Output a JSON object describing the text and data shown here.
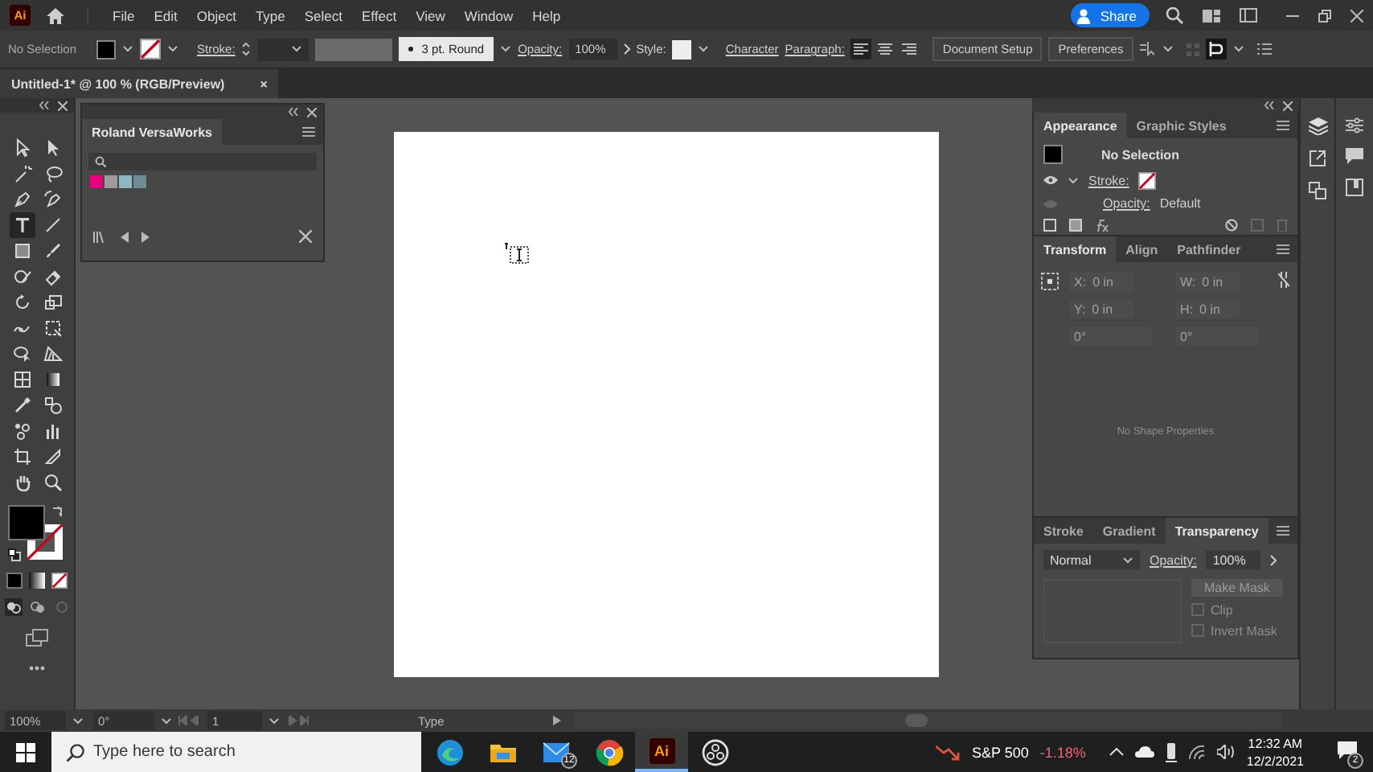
{
  "app_bar": {
    "logo": "Ai",
    "menus": [
      "File",
      "Edit",
      "Object",
      "Type",
      "Select",
      "Effect",
      "View",
      "Window",
      "Help"
    ],
    "share": "Share"
  },
  "control_bar": {
    "selection": "No Selection",
    "stroke_label": "Stroke:",
    "brush": "3 pt. Round",
    "opacity_label": "Opacity:",
    "opacity": "100%",
    "style_label": "Style:",
    "character": "Character",
    "paragraph_label": "Paragraph:",
    "alignment": [
      {
        "selected": true
      },
      {
        "selected": false
      },
      {
        "selected": false
      }
    ],
    "document_setup": "Document Setup",
    "preferences": "Preferences"
  },
  "document_tab": {
    "title": "Untitled-1* @ 100 % (RGB/Preview)",
    "close": "×"
  },
  "tools": [
    {
      "kind": "selection",
      "selected": false
    },
    {
      "kind": "direct-selection",
      "selected": false
    },
    {
      "kind": "magic-wand",
      "selected": false
    },
    {
      "kind": "lasso",
      "selected": false
    },
    {
      "kind": "pen",
      "selected": false
    },
    {
      "kind": "curvature",
      "selected": false
    },
    {
      "kind": "type",
      "selected": true
    },
    {
      "kind": "line",
      "selected": false
    },
    {
      "kind": "rectangle",
      "selected": false
    },
    {
      "kind": "paintbrush",
      "selected": false
    },
    {
      "kind": "shaper",
      "selected": false
    },
    {
      "kind": "eraser",
      "selected": false
    },
    {
      "kind": "rotate",
      "selected": false
    },
    {
      "kind": "scale",
      "selected": false
    },
    {
      "kind": "puppet-warp",
      "selected": false
    },
    {
      "kind": "free-transform",
      "selected": false
    },
    {
      "kind": "shape-builder",
      "selected": false
    },
    {
      "kind": "perspective",
      "selected": false
    },
    {
      "kind": "mesh",
      "selected": false
    },
    {
      "kind": "gradient",
      "selected": false
    },
    {
      "kind": "eyedropper",
      "selected": false
    },
    {
      "kind": "blend",
      "selected": false
    },
    {
      "kind": "symbol-sprayer",
      "selected": false
    },
    {
      "kind": "graph",
      "selected": false
    },
    {
      "kind": "artboard",
      "selected": false
    },
    {
      "kind": "slice",
      "selected": false
    },
    {
      "kind": "hand",
      "selected": false
    },
    {
      "kind": "zoom",
      "selected": false
    }
  ],
  "swatches_panel": {
    "title": "Roland VersaWorks",
    "swatches": [
      {
        "color": "#e6007e"
      },
      {
        "color": "#a09a9c"
      },
      {
        "color": "#8cb8c0"
      },
      {
        "color": "#6f8b95"
      }
    ]
  },
  "appearance_panel": {
    "tabs": [
      {
        "label": "Appearance",
        "selected": true
      },
      {
        "label": "Graphic Styles",
        "selected": false
      }
    ],
    "heading": "No Selection",
    "stroke_label": "Stroke:",
    "opacity_label": "Opacity:",
    "opacity_value": "Default"
  },
  "transform_panel": {
    "tabs": [
      {
        "label": "Transform",
        "selected": true
      },
      {
        "label": "Align",
        "selected": false
      },
      {
        "label": "Pathfinder",
        "selected": false
      }
    ],
    "fields": [
      {
        "label": "X:",
        "value": "0 in"
      },
      {
        "label": "W:",
        "value": "0 in"
      },
      {
        "label": "Y:",
        "value": "0 in"
      },
      {
        "label": "H:",
        "value": "0 in"
      }
    ],
    "angles": [
      "0°",
      "0°"
    ],
    "message": "No Shape Properties"
  },
  "transparency_panel": {
    "tabs": [
      {
        "label": "Stroke",
        "selected": false
      },
      {
        "label": "Gradient",
        "selected": false
      },
      {
        "label": "Transparency",
        "selected": true
      }
    ],
    "blend_mode": "Normal",
    "opacity_label": "Opacity:",
    "opacity": "100%",
    "make_mask": "Make Mask",
    "options": [
      {
        "label": "Clip",
        "checked": false
      },
      {
        "label": "Invert Mask",
        "checked": false
      }
    ]
  },
  "status_bar": {
    "zoom": "100%",
    "rotation": "0°",
    "artboard": "1",
    "tool": "Type"
  },
  "taskbar": {
    "search_placeholder": "Type here to search",
    "apps": [
      {
        "kind": "edge",
        "selected": false
      },
      {
        "kind": "folder",
        "selected": false
      },
      {
        "kind": "mail",
        "selected": false,
        "badge": "12"
      },
      {
        "kind": "chrome",
        "selected": false
      },
      {
        "kind": "illustrator",
        "selected": true,
        "label": "Ai"
      },
      {
        "kind": "obs",
        "selected": false
      }
    ],
    "stock": {
      "name": "S&P 500",
      "change": "-1.18%"
    },
    "time": "12:32 AM",
    "date": "12/2/2021",
    "notifications": "2"
  }
}
